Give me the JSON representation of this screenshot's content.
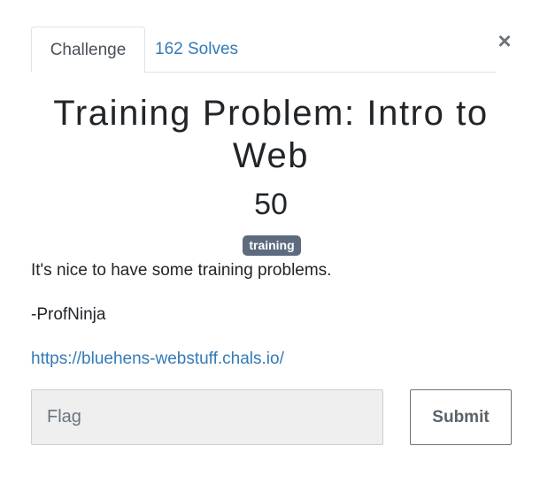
{
  "tabs": [
    {
      "label": "Challenge",
      "active": true
    },
    {
      "label": "162 Solves",
      "active": false
    }
  ],
  "close_symbol": "×",
  "challenge": {
    "title": "Training Problem: Intro to Web",
    "points": "50",
    "tag": "training",
    "description_line1": "It's nice to have some training problems.",
    "description_line2": "-ProfNinja",
    "link": "https://bluehens-webstuff.chals.io/"
  },
  "form": {
    "flag_placeholder": "Flag",
    "flag_value": "",
    "submit_label": "Submit"
  },
  "colors": {
    "link": "#337ab7",
    "badge": "#5e6b7f",
    "input_bg": "#efefef"
  }
}
